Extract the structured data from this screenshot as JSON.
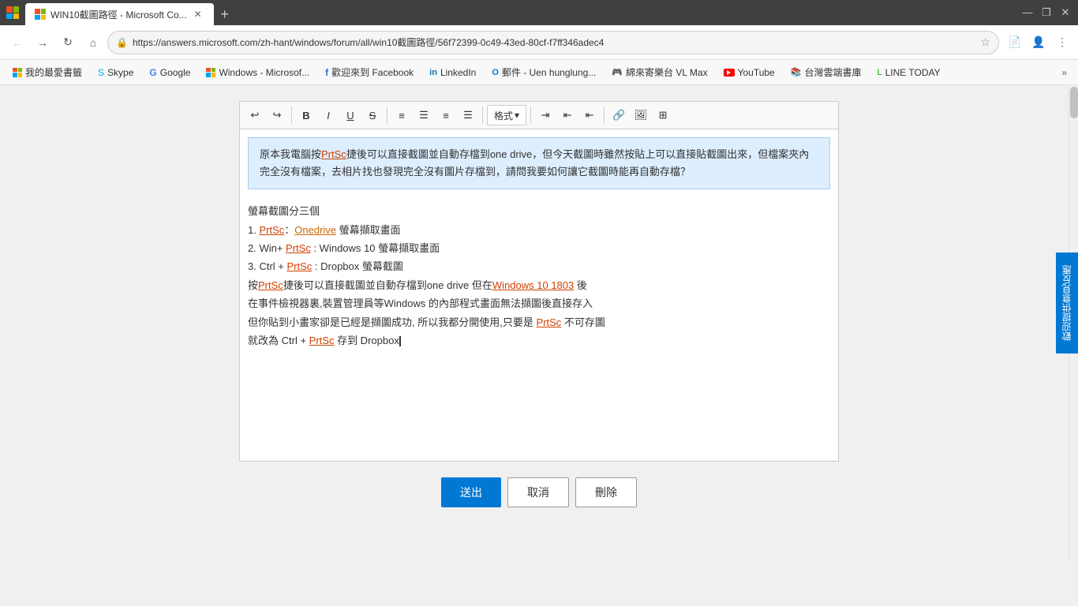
{
  "browser": {
    "titlebar": {
      "tab_title": "WIN10截圖路徑 - Microsoft Co...",
      "new_tab_label": "+",
      "controls": {
        "minimize": "—",
        "maximize": "❐",
        "close": "✕"
      }
    },
    "navbar": {
      "back_tooltip": "上一頁",
      "forward_tooltip": "下一頁",
      "refresh_tooltip": "重新整理",
      "home_tooltip": "首頁",
      "url": "https://answers.microsoft.com/zh-hant/windows/forum/all/win10截圖路徑/56f72399-0c49-43ed-80cf-f7ff346adec4",
      "star_tooltip": "將此頁面加入我的最愛",
      "settings_tooltip": "設定"
    },
    "bookmarks": [
      {
        "id": "my-favorites",
        "label": "我的最愛書籤",
        "type": "winlogo"
      },
      {
        "id": "skype",
        "label": "Skype",
        "type": "text"
      },
      {
        "id": "google",
        "label": "Google",
        "type": "text"
      },
      {
        "id": "windows-ms",
        "label": "Windows - Microsof...",
        "type": "winlogo"
      },
      {
        "id": "facebook",
        "label": "歡迎來到 Facebook",
        "type": "fb"
      },
      {
        "id": "linkedin",
        "label": "LinkedIn",
        "type": "li"
      },
      {
        "id": "outlook",
        "label": "郵件 - Uen hunglung...",
        "type": "text"
      },
      {
        "id": "vlmax",
        "label": "綿來寄樂台 VL Max",
        "type": "text"
      },
      {
        "id": "youtube",
        "label": "YouTube",
        "type": "yt"
      },
      {
        "id": "1e",
        "label": "台灣雲端書庫",
        "type": "text"
      },
      {
        "id": "linetoday",
        "label": "LINE TODAY",
        "type": "text"
      }
    ]
  },
  "editor": {
    "toolbar": {
      "undo_label": "↩",
      "redo_label": "↪",
      "bold_label": "B",
      "italic_label": "I",
      "underline_label": "U",
      "strikethrough_label": "S̶",
      "align_left": "≡",
      "align_center": "≡",
      "align_right": "≡",
      "align_justify": "≡",
      "format_label": "格式",
      "indent_increase": "⇥",
      "indent_decrease": "⇤",
      "outdent": "⇤",
      "link": "🔗",
      "image": "🖼",
      "table": "⊞"
    },
    "quoted_content": "原本我電腦按PrtSc捷後可以直接截圖並自動存檔到one drive，但今天截圖時雖然按貼上可以直接貼截圖出來，但檔案夾內完全沒有檔案，去相片找也發現完全沒有圖片存檔到，請問我要如何讓它截圖時能再自動存檔？",
    "reply_lines": [
      {
        "id": "line1",
        "text": "螢幕截圖分三個"
      },
      {
        "id": "line2",
        "prefix": "1. ",
        "link_text": "PrtSc",
        "link_color": "red",
        "separator": "：",
        "link2_text": "Onedrive",
        "link2_color": "orange",
        "suffix": " 螢幕擷取畫面"
      },
      {
        "id": "line3",
        "prefix": "2. Win+",
        "link_text": "PrtSc",
        "link_color": "red",
        "suffix": ": Windows 10 螢幕擷取畫面"
      },
      {
        "id": "line4",
        "prefix": "3. Ctrl +",
        "link_text": "PrtSc",
        "link_color": "red",
        "suffix": ": Dropbox 螢幕截圖"
      },
      {
        "id": "line5",
        "prefix": "按",
        "link_text": "PrtSc",
        "link_color": "red",
        "suffix1": "捷後可以直接截圖並自動存檔到one drive 但在",
        "link2_text": "Windows 10 1803",
        "link2_color": "red",
        "suffix2": " 後"
      },
      {
        "id": "line6",
        "text": "在事件檢視器裏,裝置管理員等Windows 的內部程式畫面無法擷圖後直接存入"
      },
      {
        "id": "line7",
        "prefix": "但你貼到小畫家卻是已經是擷圖成功, 所以我都分開使用,只要是",
        "link_text": "PrtSc",
        "link_color": "red",
        "suffix": " 不可存圖"
      },
      {
        "id": "line8",
        "prefix": "就改為 Ctrl +",
        "link_text": "PrtSc",
        "link_color": "red",
        "suffix": " 存到 Dropbox"
      }
    ]
  },
  "actions": {
    "submit_label": "送出",
    "cancel_label": "取消",
    "delete_label": "刪除"
  },
  "feedback": {
    "sidebar_label": "歡迎提供意見反應"
  }
}
